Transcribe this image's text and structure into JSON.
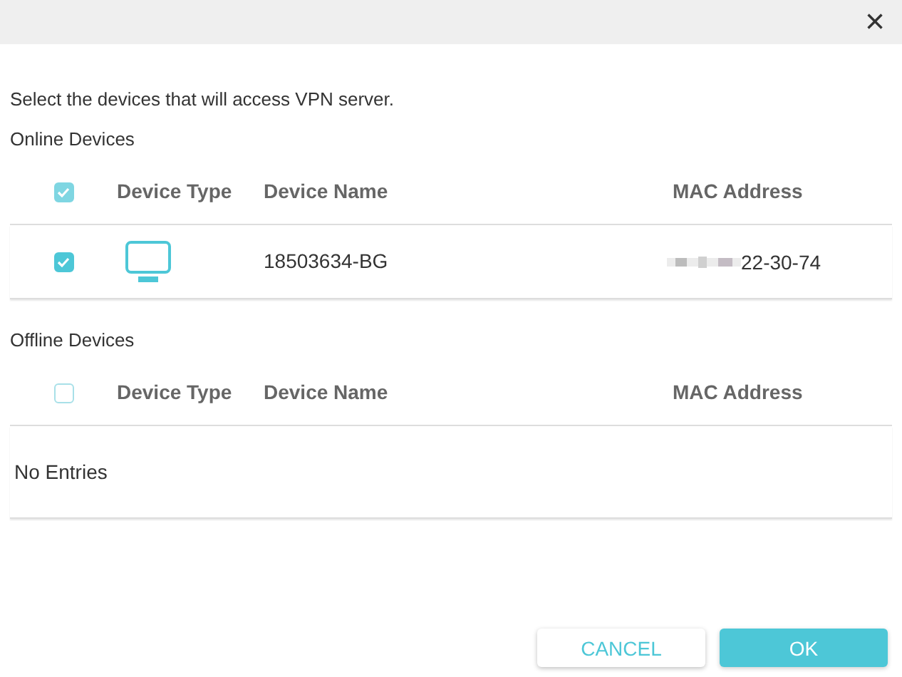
{
  "close_button": "×",
  "instruction": "Select the devices that will access VPN server.",
  "sections": [
    {
      "title": "Online Devices",
      "select_all_checked": true,
      "columns": [
        "Device Type",
        "Device Name",
        "MAC Address"
      ],
      "rows": [
        {
          "checked": true,
          "device_name": "18503634-BG",
          "mac_address": "22-30-74"
        }
      ]
    },
    {
      "title": "Offline Devices",
      "select_all_checked": false,
      "columns": [
        "Device Type",
        "Device Name",
        "MAC Address"
      ],
      "empty_text": "No Entries"
    }
  ],
  "buttons": [
    {
      "label": "CANCEL",
      "kind": "secondary"
    },
    {
      "label": "OK",
      "kind": "primary"
    }
  ]
}
